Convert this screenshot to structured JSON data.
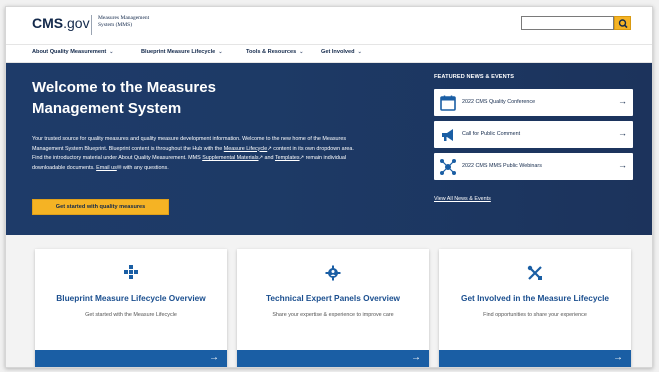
{
  "header": {
    "logo_main": "CMS",
    "logo_tld": ".gov",
    "logo_sub_line1": "Measures Management",
    "logo_sub_line2": "System (MMS)",
    "search_placeholder": "",
    "search_icon": "search-icon"
  },
  "nav": {
    "items": [
      {
        "label": "About Quality Measurement"
      },
      {
        "label": "Blueprint Measure Lifecycle"
      },
      {
        "label": "Tools & Resources"
      },
      {
        "label": "Get Involved"
      }
    ],
    "chevron": "⌄"
  },
  "hero": {
    "title": "Welcome to the Measures Management System",
    "text_1": "Your trusted source for quality measures and quality measure development information. Welcome to the new home of the Measures Management System Blueprint. Blueprint content is throughout the Hub with the ",
    "link_lifecycle": "Measure Lifecycle",
    "text_2": " content in its own dropdown area. Find the introductory material under About Quality Measurement. MMS ",
    "link_supplemental": "Supplemental Materials",
    "text_3": " and ",
    "link_templates": "Templates",
    "text_4": " remain individual downloadable documents. ",
    "link_email": "Email us",
    "text_5": " with any questions.",
    "cta_label": "Get started with quality measures"
  },
  "featured": {
    "heading": "FEATURED NEWS & EVENTS",
    "items": [
      {
        "label": "2022 CMS Quality Conference",
        "icon": "calendar-icon"
      },
      {
        "label": "Call for Public Comment",
        "icon": "megaphone-icon"
      },
      {
        "label": "2022 CMS MMS Public Webinars",
        "icon": "webinar-network-icon"
      }
    ],
    "view_all": "View All News & Events"
  },
  "cards": [
    {
      "title": "Blueprint Measure Lifecycle Overview",
      "desc": "Get started with the Measure Lifecycle",
      "icon": "lifecycle-icon"
    },
    {
      "title": "Technical Expert Panels Overview",
      "desc": "Share your expertise & experience to improve care",
      "icon": "gear-people-icon"
    },
    {
      "title": "Get Involved in the Measure Lifecycle",
      "desc": "Find opportunities to share your experience",
      "icon": "tools-icon"
    }
  ],
  "colors": {
    "navy": "#13294b",
    "hero": "#1e3b69",
    "gold": "#f5b324",
    "card_blue": "#1a5ea4"
  }
}
